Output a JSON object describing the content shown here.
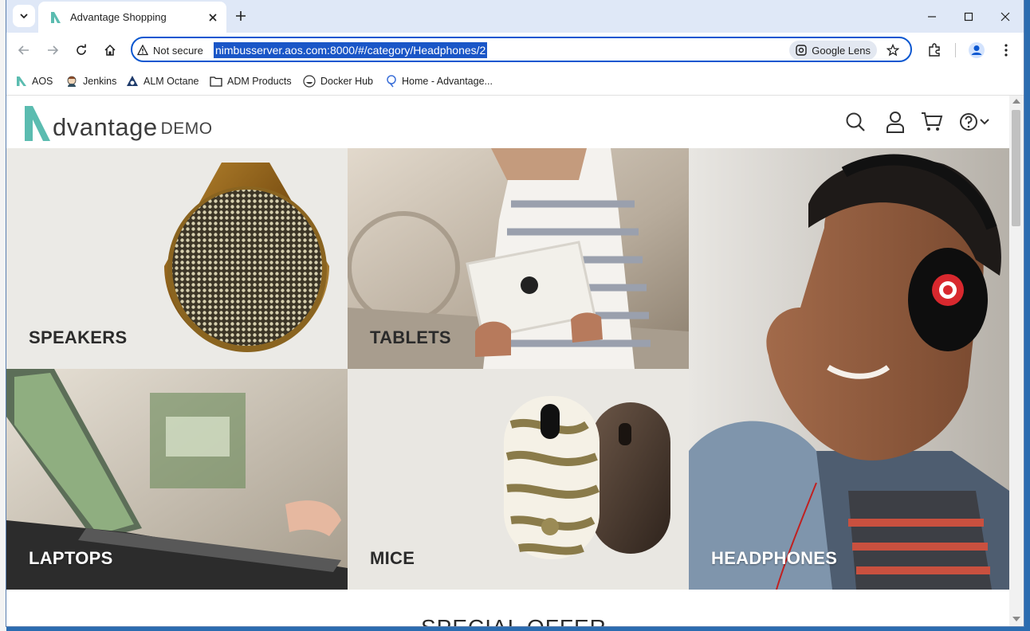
{
  "browser": {
    "tab_title": "Advantage Shopping",
    "url": "nimbusserver.aos.com:8000/#/category/Headphones/2",
    "security_label": "Not secure",
    "lens_label": "Google Lens"
  },
  "bookmarks": [
    {
      "label": "AOS",
      "icon": "aos-logo-icon"
    },
    {
      "label": "Jenkins",
      "icon": "jenkins-icon"
    },
    {
      "label": "ALM Octane",
      "icon": "octane-icon"
    },
    {
      "label": "ADM Products",
      "icon": "folder-icon"
    },
    {
      "label": "Docker Hub",
      "icon": "docker-icon"
    },
    {
      "label": "Home - Advantage...",
      "icon": "home-advantage-icon"
    }
  ],
  "site": {
    "logo_word": "dvantage",
    "logo_demo": "DEMO"
  },
  "categories": [
    {
      "label": "SPEAKERS"
    },
    {
      "label": "TABLETS"
    },
    {
      "label": "HEADPHONES"
    },
    {
      "label": "LAPTOPS"
    },
    {
      "label": "MICE"
    }
  ],
  "section_heading": "SPECIAL OFFER",
  "colors": {
    "brand_teal": "#5bbcb0",
    "tab_bar": "#dfe8f7",
    "url_highlight": "#1a56c7"
  }
}
